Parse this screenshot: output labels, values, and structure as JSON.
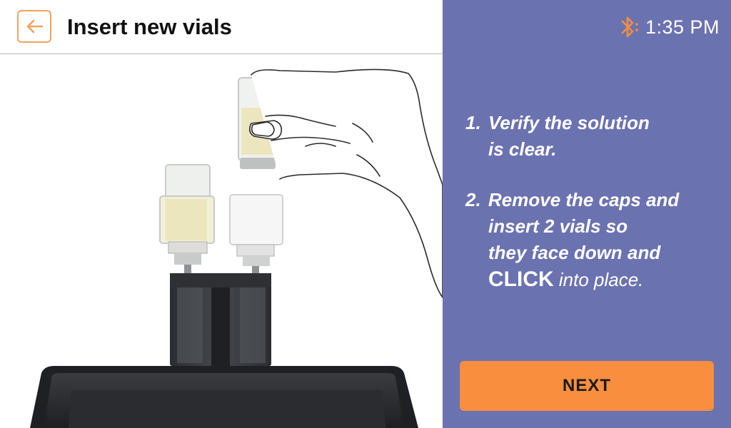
{
  "header": {
    "title": "Insert new vials",
    "back_icon": "arrow-left-icon",
    "accent_color": "#f4a261"
  },
  "status": {
    "bluetooth_icon": "bluetooth-icon",
    "time": "1:35 PM"
  },
  "instructions": {
    "step1": {
      "number": "1.",
      "line1": "Verify the solution",
      "line2": "is clear."
    },
    "step2": {
      "number": "2.",
      "line1": "Remove the caps and",
      "line2": "insert 2 vials so",
      "line3": "they face down and",
      "emphasis": "CLICK",
      "line4_rest": " into place."
    }
  },
  "actions": {
    "next_label": "NEXT",
    "next_color": "#f98e3e"
  },
  "panel_color": "#6b72b0"
}
